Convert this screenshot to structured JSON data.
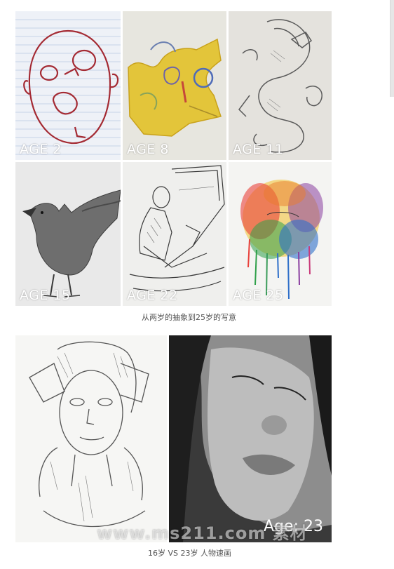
{
  "top_grid": {
    "cells": [
      {
        "label": "AGE 2"
      },
      {
        "label": "AGE 8"
      },
      {
        "label": "AGE 11"
      },
      {
        "label": "AGE 15"
      },
      {
        "label": "AGE 22"
      },
      {
        "label": "AGE 25"
      }
    ],
    "caption": "从两岁的抽象到25岁的写意"
  },
  "bottom_pair": {
    "age_label": "Age: 23",
    "watermark": "www.ms211.com 素材",
    "caption": "16岁 VS 23岁 人物速画"
  }
}
